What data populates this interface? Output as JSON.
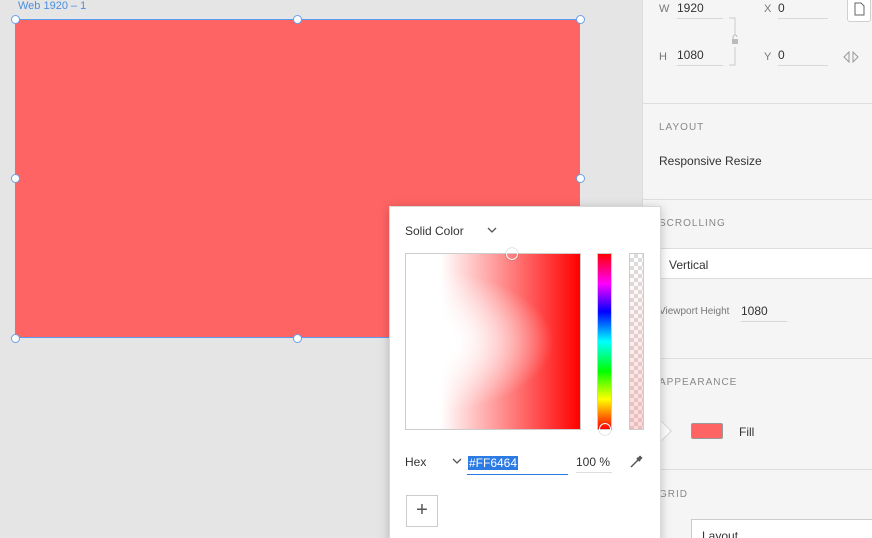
{
  "artboard": {
    "label": "Web 1920 – 1",
    "fill": "#ff6464"
  },
  "panel": {
    "w_label": "W",
    "w_value": "1920",
    "x_label": "X",
    "x_value": "0",
    "h_label": "H",
    "h_value": "1080",
    "y_label": "Y",
    "y_value": "0",
    "layout_title": "LAYOUT",
    "responsive_resize": "Responsive Resize",
    "scrolling_title": "SCROLLING",
    "scrolling_value": "Vertical",
    "viewport_label": "Viewport Height",
    "viewport_value": "1080",
    "appearance_title": "APPEARANCE",
    "fill_label": "Fill",
    "grid_title": "GRID",
    "grid_value": "Layout"
  },
  "picker": {
    "mode": "Solid Color",
    "format": "Hex",
    "hex_value": "#FF6464",
    "opacity": "100 %",
    "add_label": "+"
  }
}
